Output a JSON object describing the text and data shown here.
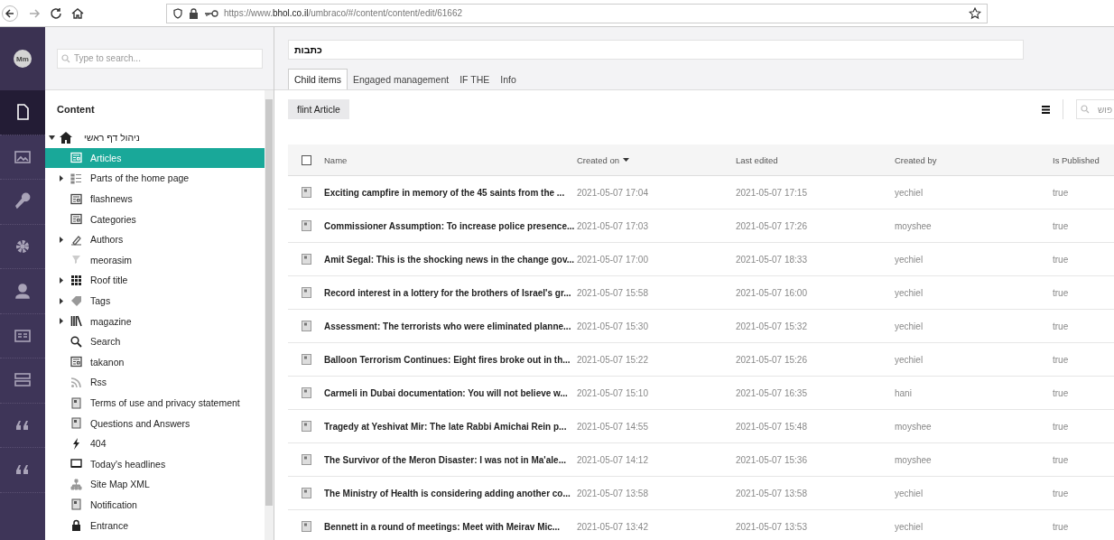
{
  "browser": {
    "url": "https://www.**bhol.co.il**/umbraco/#/content/content/edit/61662",
    "forward_disabled": true
  },
  "rail": {
    "avatar": "Mm",
    "items": [
      {
        "selected": true
      },
      {
        "selected": false
      },
      {
        "selected": false
      },
      {
        "selected": false
      },
      {
        "selected": false
      },
      {
        "selected": false
      },
      {
        "selected": false
      },
      {
        "selected": false
      },
      {
        "selected": false
      }
    ]
  },
  "tree": {
    "search_placeholder": "Type to search...",
    "heading": "Content",
    "root": {
      "label": "ניהול דף ראשי",
      "expanded": true,
      "children": [
        {
          "label": "Articles",
          "selected": true,
          "has_children": false
        },
        {
          "label": "Parts of the home page",
          "selected": false,
          "has_children": true
        },
        {
          "label": "flashnews",
          "selected": false,
          "has_children": false
        },
        {
          "label": "Categories",
          "selected": false,
          "has_children": false
        },
        {
          "label": "Authors",
          "selected": false,
          "has_children": true
        },
        {
          "label": "meorasim",
          "selected": false,
          "has_children": false
        },
        {
          "label": "Roof title",
          "selected": false,
          "has_children": true
        },
        {
          "label": "Tags",
          "selected": false,
          "has_children": true
        },
        {
          "label": "magazine",
          "selected": false,
          "has_children": true
        },
        {
          "label": "Search",
          "selected": false,
          "has_children": false
        },
        {
          "label": "takanon",
          "selected": false,
          "has_children": false
        },
        {
          "label": "Rss",
          "selected": false,
          "has_children": false
        },
        {
          "label": "Terms of use and privacy statement",
          "selected": false,
          "has_children": false
        },
        {
          "label": "Questions and Answers",
          "selected": false,
          "has_children": false
        },
        {
          "label": "404",
          "selected": false,
          "has_children": false
        },
        {
          "label": "Today's headlines",
          "selected": false,
          "has_children": false
        },
        {
          "label": "Site Map XML",
          "selected": false,
          "has_children": false
        },
        {
          "label": "Notification",
          "selected": false,
          "has_children": false
        },
        {
          "label": "Entrance",
          "selected": false,
          "has_children": false
        }
      ]
    }
  },
  "editor": {
    "name": "כתבות",
    "tabs": [
      {
        "label": "Child items",
        "selected": true
      },
      {
        "label": "Engaged management",
        "selected": false
      },
      {
        "label": "IF THE",
        "selected": false
      },
      {
        "label": "Info",
        "selected": false
      }
    ],
    "create_button": "flint Article",
    "search_placeholder": "פוש"
  },
  "table": {
    "columns": [
      {
        "label": "Name",
        "sorted": false
      },
      {
        "label": "Created on",
        "sorted": true
      },
      {
        "label": "Last edited",
        "sorted": false
      },
      {
        "label": "Created by",
        "sorted": false
      },
      {
        "label": "Is Published",
        "sorted": false
      }
    ],
    "select_all_checked": false,
    "rows": [
      {
        "name": "Exciting campfire in memory of the 45 saints from the ...",
        "created": "2021-05-07 17:04",
        "edited": "2021-05-07 17:15",
        "by": "yechiel",
        "published": "true"
      },
      {
        "name": "Commissioner Assumption: To increase police presence...",
        "created": "2021-05-07 17:03",
        "edited": "2021-05-07 17:26",
        "by": "moyshee",
        "published": "true"
      },
      {
        "name": "Amit Segal: This is the shocking news in the change gov...",
        "created": "2021-05-07 17:00",
        "edited": "2021-05-07 18:33",
        "by": "yechiel",
        "published": "true"
      },
      {
        "name": "Record interest in a lottery for the brothers of Israel's gr...",
        "created": "2021-05-07 15:58",
        "edited": "2021-05-07 16:00",
        "by": "yechiel",
        "published": "true"
      },
      {
        "name": "Assessment: The terrorists who were eliminated planne...",
        "created": "2021-05-07 15:30",
        "edited": "2021-05-07 15:32",
        "by": "yechiel",
        "published": "true"
      },
      {
        "name": "Balloon Terrorism Continues: Eight fires broke out in th...",
        "created": "2021-05-07 15:22",
        "edited": "2021-05-07 15:26",
        "by": "yechiel",
        "published": "true"
      },
      {
        "name": "Carmeli in Dubai documentation: You will not believe w...",
        "created": "2021-05-07 15:10",
        "edited": "2021-05-07 16:35",
        "by": "hani",
        "published": "true"
      },
      {
        "name": "Tragedy at Yeshivat Mir: The late Rabbi Amichai Rein p...",
        "created": "2021-05-07 14:55",
        "edited": "2021-05-07 15:48",
        "by": "moyshee",
        "published": "true"
      },
      {
        "name": "The Survivor of the Meron Disaster: I was not in Ma'ale...",
        "created": "2021-05-07 14:12",
        "edited": "2021-05-07 15:36",
        "by": "moyshee",
        "published": "true"
      },
      {
        "name": "The Ministry of Health is considering adding another co...",
        "created": "2021-05-07 13:58",
        "edited": "2021-05-07 13:58",
        "by": "yechiel",
        "published": "true"
      },
      {
        "name": "Bennett in a round of meetings: Meet with Meirav Mic...",
        "created": "2021-05-07 13:42",
        "edited": "2021-05-07 13:53",
        "by": "yechiel",
        "published": "true"
      }
    ]
  }
}
